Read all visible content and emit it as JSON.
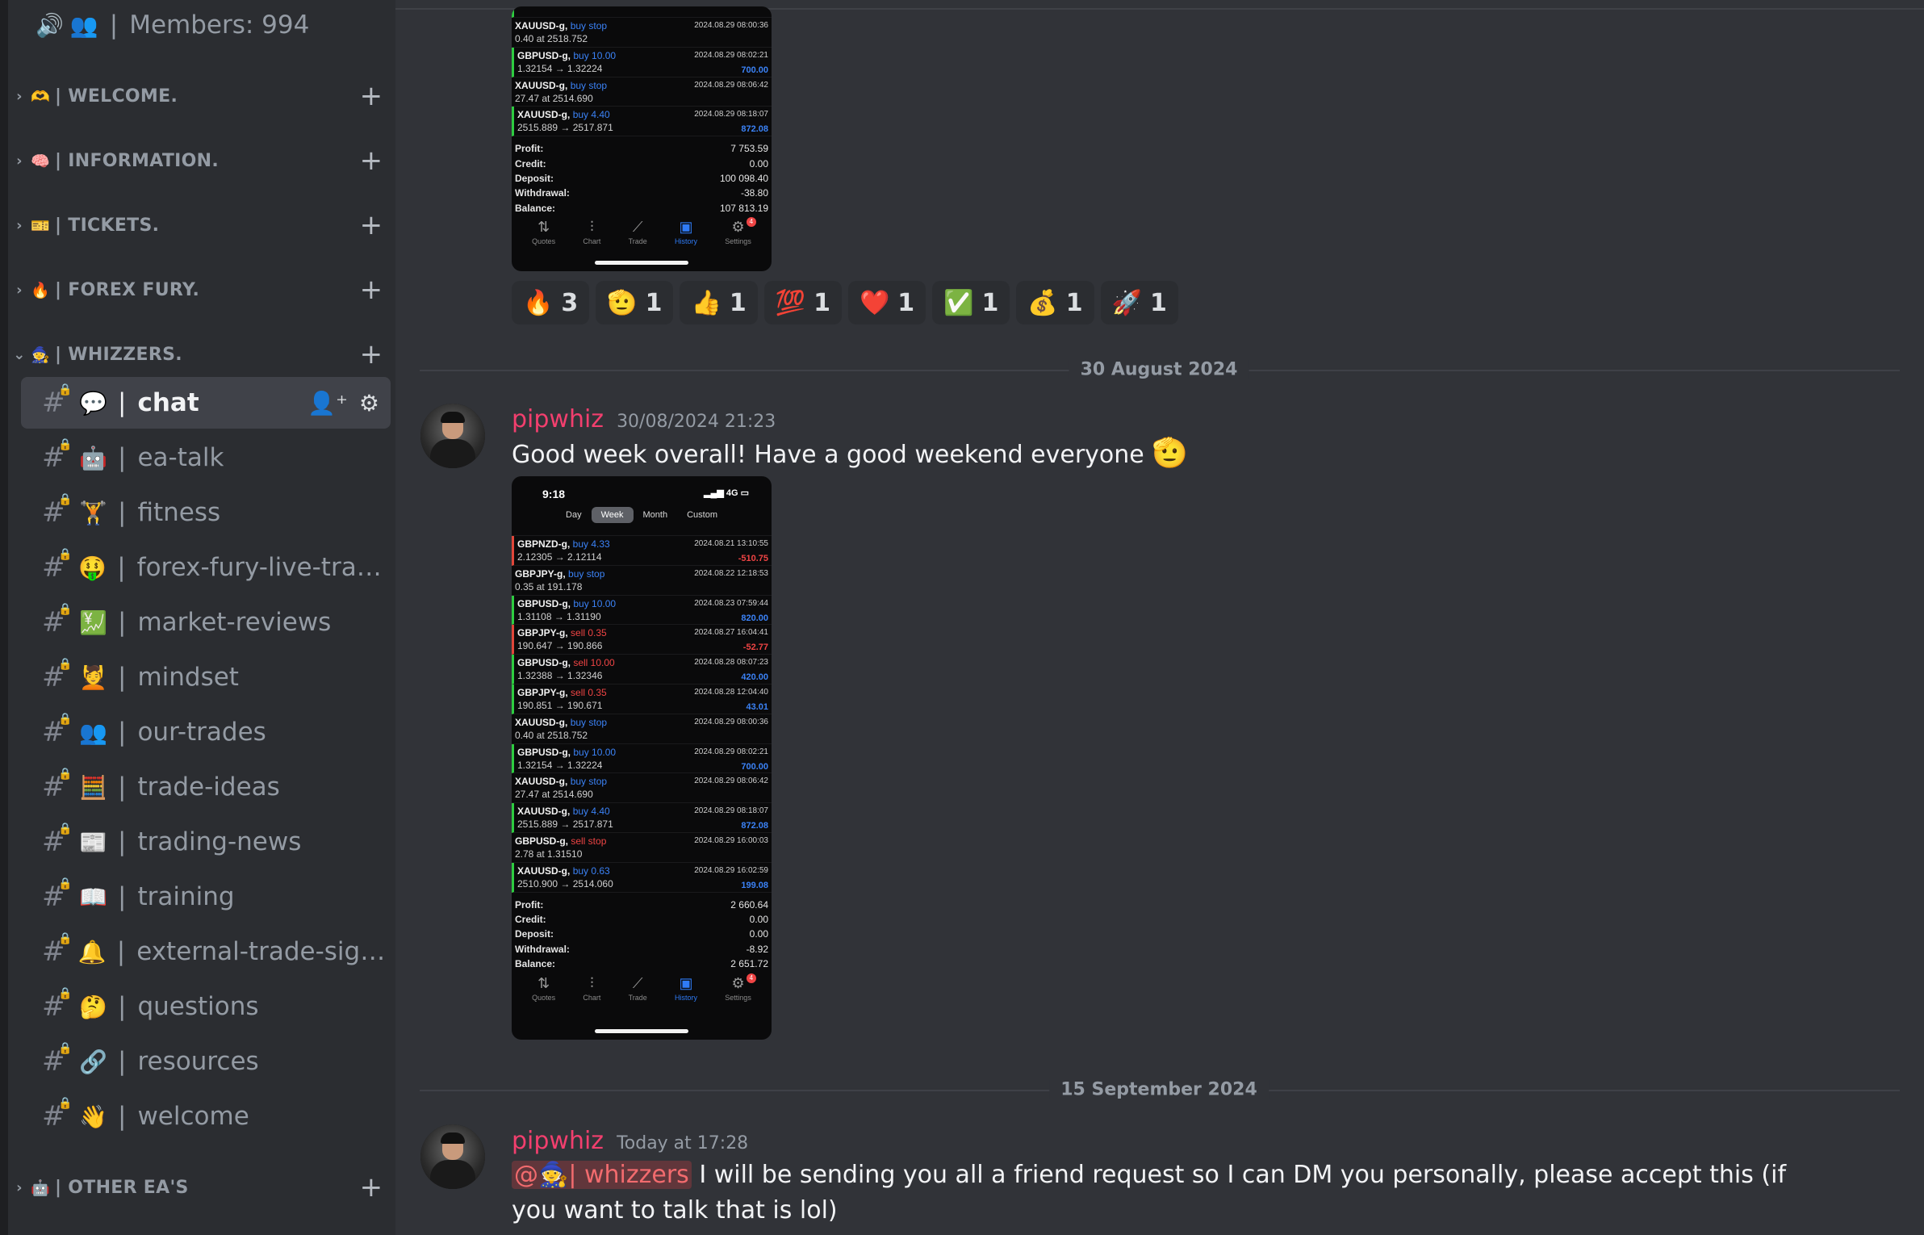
{
  "sidebar": {
    "members_row": {
      "emoji": "👥",
      "label": "Members: 994"
    },
    "categories": [
      {
        "emoji": "🫶",
        "label": "| WELCOME."
      },
      {
        "emoji": "🧠",
        "label": "| INFORMATION."
      },
      {
        "emoji": "🎫",
        "label": "| TICKETS."
      },
      {
        "emoji": "🔥",
        "label": "| FOREX FURY."
      },
      {
        "emoji": "🧙",
        "label": "| WHIZZERS."
      },
      {
        "emoji": "🤖",
        "label": "| OTHER EA'S"
      }
    ],
    "channels": [
      {
        "emoji": "💬",
        "label": "chat",
        "active": true
      },
      {
        "emoji": "🤖",
        "label": "ea-talk"
      },
      {
        "emoji": "🏋",
        "label": "fitness"
      },
      {
        "emoji": "🤑",
        "label": "forex-fury-live-trad..."
      },
      {
        "emoji": "💹",
        "label": "market-reviews"
      },
      {
        "emoji": "💆",
        "label": "mindset"
      },
      {
        "emoji": "👥",
        "label": "our-trades"
      },
      {
        "emoji": "🧮",
        "label": "trade-ideas"
      },
      {
        "emoji": "📰",
        "label": "trading-news"
      },
      {
        "emoji": "📖",
        "label": "training"
      },
      {
        "emoji": "🔔",
        "label": "external-trade-sign..."
      },
      {
        "emoji": "🤔",
        "label": "questions"
      },
      {
        "emoji": "🔗",
        "label": "resources"
      },
      {
        "emoji": "👋",
        "label": "welcome"
      }
    ]
  },
  "embed1": {
    "top_rows": [
      {
        "sym": "XAUUSD-g,",
        "act": "buy stop",
        "dt": "2024.08.29 08:00:36",
        "price": "0.40 at 2518.752",
        "pl": ""
      },
      {
        "sym": "GBPUSD-g,",
        "act": "buy 10.00",
        "dt": "2024.08.29 08:02:21",
        "price": "1.32154 → 1.32224",
        "pl": "700.00",
        "side": "g"
      },
      {
        "sym": "XAUUSD-g,",
        "act": "buy stop",
        "dt": "2024.08.29 08:06:42",
        "price": "27.47 at 2514.690",
        "pl": ""
      },
      {
        "sym": "XAUUSD-g,",
        "act": "buy 4.40",
        "dt": "2024.08.29 08:18:07",
        "price": "2515.889 → 2517.871",
        "pl": "872.08",
        "side": "g"
      }
    ],
    "summary": [
      {
        "k": "Profit:",
        "v": "7 753.59"
      },
      {
        "k": "Credit:",
        "v": "0.00"
      },
      {
        "k": "Deposit:",
        "v": "100 098.40"
      },
      {
        "k": "Withdrawal:",
        "v": "-38.80"
      },
      {
        "k": "Balance:",
        "v": "107 813.19"
      }
    ]
  },
  "nav": [
    "Quotes",
    "Chart",
    "Trade",
    "History",
    "Settings"
  ],
  "nav_badge": "4",
  "reactions": [
    {
      "emoji": "🔥",
      "count": "3"
    },
    {
      "emoji": "🫡",
      "count": "1"
    },
    {
      "emoji": "👍",
      "count": "1"
    },
    {
      "emoji": "💯",
      "count": "1"
    },
    {
      "emoji": "❤️",
      "count": "1"
    },
    {
      "emoji": "✅",
      "count": "1"
    },
    {
      "emoji": "💰",
      "count": "1"
    },
    {
      "emoji": "🚀",
      "count": "1"
    }
  ],
  "dividers": [
    "30 August 2024",
    "15 September 2024"
  ],
  "message1": {
    "author": "pipwhiz",
    "time": "30/08/2024 21:23",
    "text": "Good week overall! Have a good weekend everyone",
    "emoji": "🫡"
  },
  "embed2": {
    "status_time": "9:18",
    "status_right": "4G",
    "segments": [
      "Day",
      "Week",
      "Month",
      "Custom"
    ],
    "active_segment": "Week",
    "rows": [
      {
        "sym": "GBPNZD-g,",
        "act": "buy 4.33",
        "dt": "2024.08.21 13:10:55",
        "price": "2.12305 → 2.12114",
        "pl": "-510.75",
        "side": "r",
        "sell": false
      },
      {
        "sym": "GBPJPY-g,",
        "act": "buy stop",
        "dt": "2024.08.22 12:18:53",
        "price": "0.35 at 191.178",
        "pl": "",
        "side": "",
        "sell": false
      },
      {
        "sym": "GBPUSD-g,",
        "act": "buy 10.00",
        "dt": "2024.08.23 07:59:44",
        "price": "1.31108 → 1.31190",
        "pl": "820.00",
        "side": "g",
        "sell": false
      },
      {
        "sym": "GBPJPY-g,",
        "act": "sell 0.35",
        "dt": "2024.08.27 16:04:41",
        "price": "190.647 → 190.866",
        "pl": "-52.77",
        "side": "r",
        "sell": true
      },
      {
        "sym": "GBPUSD-g,",
        "act": "sell 10.00",
        "dt": "2024.08.28 08:07:23",
        "price": "1.32388 → 1.32346",
        "pl": "420.00",
        "side": "g",
        "sell": true
      },
      {
        "sym": "GBPJPY-g,",
        "act": "sell 0.35",
        "dt": "2024.08.28 12:04:40",
        "price": "190.851 → 190.671",
        "pl": "43.01",
        "side": "g",
        "sell": true
      },
      {
        "sym": "XAUUSD-g,",
        "act": "buy stop",
        "dt": "2024.08.29 08:00:36",
        "price": "0.40 at 2518.752",
        "pl": "",
        "side": "",
        "sell": false
      },
      {
        "sym": "GBPUSD-g,",
        "act": "buy 10.00",
        "dt": "2024.08.29 08:02:21",
        "price": "1.32154 → 1.32224",
        "pl": "700.00",
        "side": "g",
        "sell": false
      },
      {
        "sym": "XAUUSD-g,",
        "act": "buy stop",
        "dt": "2024.08.29 08:06:42",
        "price": "27.47 at 2514.690",
        "pl": "",
        "side": "",
        "sell": false
      },
      {
        "sym": "XAUUSD-g,",
        "act": "buy 4.40",
        "dt": "2024.08.29 08:18:07",
        "price": "2515.889 → 2517.871",
        "pl": "872.08",
        "side": "g",
        "sell": false
      },
      {
        "sym": "GBPUSD-g,",
        "act": "sell stop",
        "dt": "2024.08.29 16:00:03",
        "price": "2.78 at 1.31510",
        "pl": "",
        "side": "",
        "sell": true
      },
      {
        "sym": "XAUUSD-g,",
        "act": "buy 0.63",
        "dt": "2024.08.29 16:02:59",
        "price": "2510.900 → 2514.060",
        "pl": "199.08",
        "side": "g",
        "sell": false
      }
    ],
    "summary": [
      {
        "k": "Profit:",
        "v": "2 660.64"
      },
      {
        "k": "Credit:",
        "v": "0.00"
      },
      {
        "k": "Deposit:",
        "v": "0.00"
      },
      {
        "k": "Withdrawal:",
        "v": "-8.92"
      },
      {
        "k": "Balance:",
        "v": "2 651.72"
      }
    ]
  },
  "message2": {
    "author": "pipwhiz",
    "time": "Today at 17:28",
    "mention": "@🧙| whizzers",
    "text": " I will be sending you all a friend request so I can DM you personally, please accept this (if you want to talk that is lol)"
  }
}
